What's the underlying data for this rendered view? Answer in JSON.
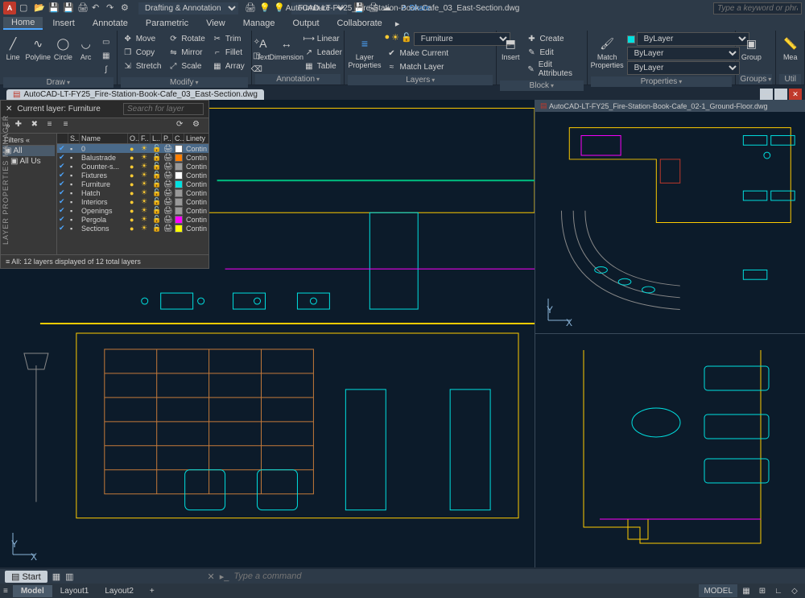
{
  "app": {
    "icon_letter": "A",
    "title": "AutoCAD-LT-FY25_Fire-Station-Book-Cafe_03_East-Section.dwg",
    "search_placeholder": "Type a keyword or phrase"
  },
  "quickaccess": {
    "workspace": "Drafting & Annotation",
    "share_label": "Share",
    "layer_shortcut": "Furniture"
  },
  "menu": [
    "Home",
    "Insert",
    "Annotate",
    "Parametric",
    "View",
    "Manage",
    "Output",
    "Collaborate"
  ],
  "menu_active": "Home",
  "ribbon": {
    "draw": {
      "title": "Draw",
      "line": "Line",
      "polyline": "Polyline",
      "circle": "Circle",
      "arc": "Arc"
    },
    "modify": {
      "title": "Modify",
      "move": "Move",
      "rotate": "Rotate",
      "trim": "Trim",
      "copy": "Copy",
      "mirror": "Mirror",
      "fillet": "Fillet",
      "stretch": "Stretch",
      "scale": "Scale",
      "array": "Array"
    },
    "annotation": {
      "title": "Annotation",
      "text": "Text",
      "dimension": "Dimension",
      "linear": "Linear",
      "leader": "Leader",
      "table": "Table"
    },
    "layers": {
      "title": "Layers",
      "layer_props": "Layer\nProperties",
      "match": "Match Layer",
      "make_current": "Make Current",
      "current": "Furniture"
    },
    "block": {
      "title": "Block",
      "insert": "Insert",
      "create": "Create",
      "edit": "Edit",
      "edit_attr": "Edit Attributes"
    },
    "properties": {
      "title": "Properties",
      "match": "Match\nProperties",
      "bylayer": "ByLayer"
    },
    "groups": {
      "title": "Groups",
      "group": "Group"
    },
    "util": {
      "title": "Util",
      "mea": "Mea"
    }
  },
  "docs": {
    "tab1": "AutoCAD-LT-FY25_Fire-Station-Book-Cafe_03_East-Section.dwg",
    "tab2": "AutoCAD-LT-FY25_Fire-Station-Book-Cafe_02-1_Ground-Floor.dwg"
  },
  "layer_panel": {
    "label": "LAYER PROPERTIES MANAGER",
    "current": "Current layer: Furniture",
    "search_placeholder": "Search for layer",
    "filters_title": "Filters",
    "filter_all": "All",
    "filter_all_used": "All Us",
    "cols": {
      "s": "S..",
      "name": "Name",
      "o": "O..",
      "f": "F..",
      "l": "L..",
      "p": "P..",
      "c": "C..",
      "linety": "Linety"
    },
    "layers": [
      {
        "name": "0",
        "color": "#ffffff",
        "lt": "Contin"
      },
      {
        "name": "Balustrade",
        "color": "#ff7f00",
        "lt": "Contin"
      },
      {
        "name": "Counter-s...",
        "color": "#999999",
        "lt": "Contin"
      },
      {
        "name": "Fixtures",
        "color": "#ffffff",
        "lt": "Contin"
      },
      {
        "name": "Furniture",
        "color": "#00e0e0",
        "lt": "Contin"
      },
      {
        "name": "Hatch",
        "color": "#999999",
        "lt": "Contin"
      },
      {
        "name": "Interiors",
        "color": "#999999",
        "lt": "Contin"
      },
      {
        "name": "Openings",
        "color": "#999999",
        "lt": "Contin"
      },
      {
        "name": "Pergola",
        "color": "#ff00ff",
        "lt": "Contin"
      },
      {
        "name": "Sections",
        "color": "#ffff00",
        "lt": "Contin"
      }
    ],
    "status": "All: 12 layers displayed of 12 total layers"
  },
  "command": {
    "placeholder": "Type a command",
    "start": "Start"
  },
  "status": {
    "model": "Model",
    "layout1": "Layout1",
    "layout2": "Layout2",
    "model_space": "MODEL",
    "plus": "+"
  }
}
